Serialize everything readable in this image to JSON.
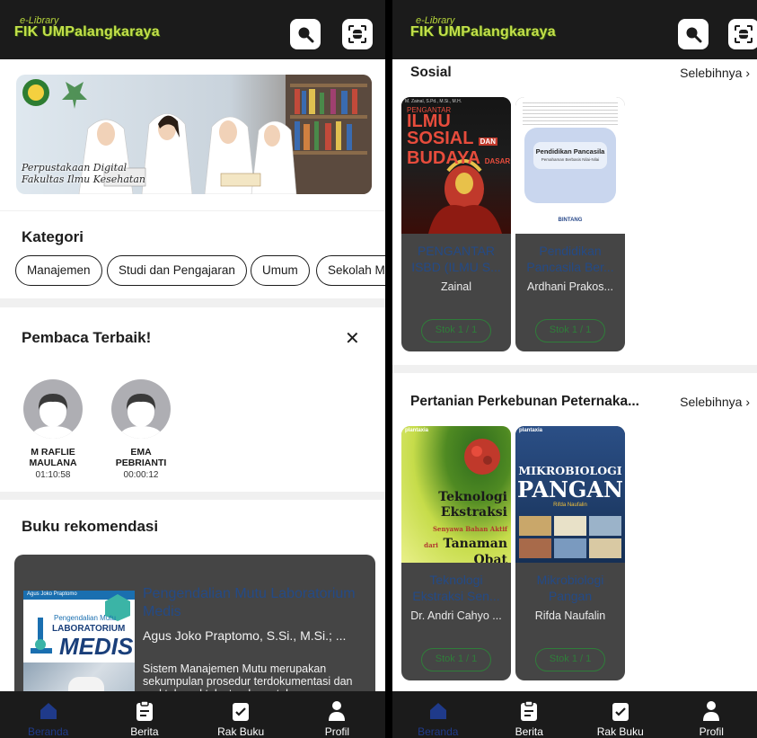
{
  "app": {
    "logo_line1": "e-Library",
    "logo_line2": "FIK UMPalangkaraya"
  },
  "icons": {
    "search": "search-icon",
    "scan": "scan-icon",
    "home": "home-icon",
    "news": "news-icon",
    "shelf": "bookshelf-icon",
    "profile": "profile-icon",
    "close": "close-icon",
    "chevron": "chevron-right-icon"
  },
  "colors": {
    "topbar": "#1b1b1b",
    "logo_accent": "#c4e04a",
    "card_dark": "#454545",
    "link_blue": "#244a86",
    "stock_green": "#2f7d3a",
    "nav_active": "#1f3a8a"
  },
  "left": {
    "banner": {
      "caption_line1": "Perpustakaan Digital",
      "caption_line2": "Fakultas Ilmu Kesehatan"
    },
    "kategori": {
      "title": "Kategori",
      "chips": [
        "Manajemen",
        "Studi dan Pengajaran",
        "Umum",
        "Sekolah M"
      ]
    },
    "pembaca": {
      "title": "Pembaca Terbaik!",
      "close_symbol": "✕",
      "readers": [
        {
          "name_line1": "M RAFLIE",
          "name_line2": "MAULANA",
          "time": "01:10:58"
        },
        {
          "name_line1": "EMA",
          "name_line2": "PEBRIANTI",
          "time": "00:00:12"
        }
      ]
    },
    "rekomendasi": {
      "title": "Buku rekomendasi",
      "book": {
        "title": "Pengendalian Mutu Laboratorium Medis",
        "author": "Agus Joko Praptomo, S.Si., M.Si.; ...",
        "description": "Sistem Manajemen Mutu merupakan sekumpulan prosedur terdokumentasi dan praktek-praktek standar untuk",
        "cover_author": "Agus Joko Praptomo",
        "cover_line1": "Pengendalian Mutu",
        "cover_line2": "LABORATORIUM",
        "cover_line3": "MEDIS"
      }
    }
  },
  "right": {
    "sections": [
      {
        "title": "Sosial",
        "more": "Selebihnya",
        "books": [
          {
            "title": "PENGANTAR ISBD (ILMU S...",
            "author": "Zainal",
            "stock": "Stok 1 / 1",
            "cover_top": "PENGANTAR",
            "cover_l1": "ILMU",
            "cover_l2": "SOSIAL",
            "cover_l3": "DAN",
            "cover_l4": "BUDAYA",
            "cover_l5": "DASAR",
            "cover_author": "M. Zainal, S.Pd., M.Si., M.H."
          },
          {
            "title": "Pendidikan Pancasila Ber...",
            "author": "Ardhani Prakos...",
            "stock": "Stok 1 / 1",
            "cover_l1": "Pendidikan Pancasila",
            "cover_l2": "Pemahaman Berbasis Nilai-Nilai",
            "cover_pub": "BINTANG"
          }
        ]
      },
      {
        "title": "Pertanian Perkebunan Peternaka...",
        "more": "Selebihnya",
        "books": [
          {
            "title": "Teknologi Ekstraksi Sen...",
            "author": "Dr. Andri Cahyo ...",
            "stock": "Stok 1 / 1",
            "cover_pub": "plantaxia",
            "cover_l1": "Teknologi",
            "cover_l2": "Ekstraksi",
            "cover_l3": "Senyawa Bahan Aktif",
            "cover_l4": "dari",
            "cover_l5": "Tanaman",
            "cover_l6": "Obat"
          },
          {
            "title": "Mikrobiologi Pangan",
            "author": "Rifda Naufalin",
            "stock": "Stok 1 / 1",
            "cover_pub": "plantaxia",
            "cover_l1": "MIKROBIOLOGI",
            "cover_l2": "PANGAN",
            "cover_author": "Rifda Naufalin"
          }
        ]
      }
    ]
  },
  "nav": {
    "items": [
      {
        "label": "Beranda",
        "active": true
      },
      {
        "label": "Berita",
        "active": false
      },
      {
        "label": "Rak Buku",
        "active": false
      },
      {
        "label": "Profil",
        "active": false
      }
    ]
  }
}
